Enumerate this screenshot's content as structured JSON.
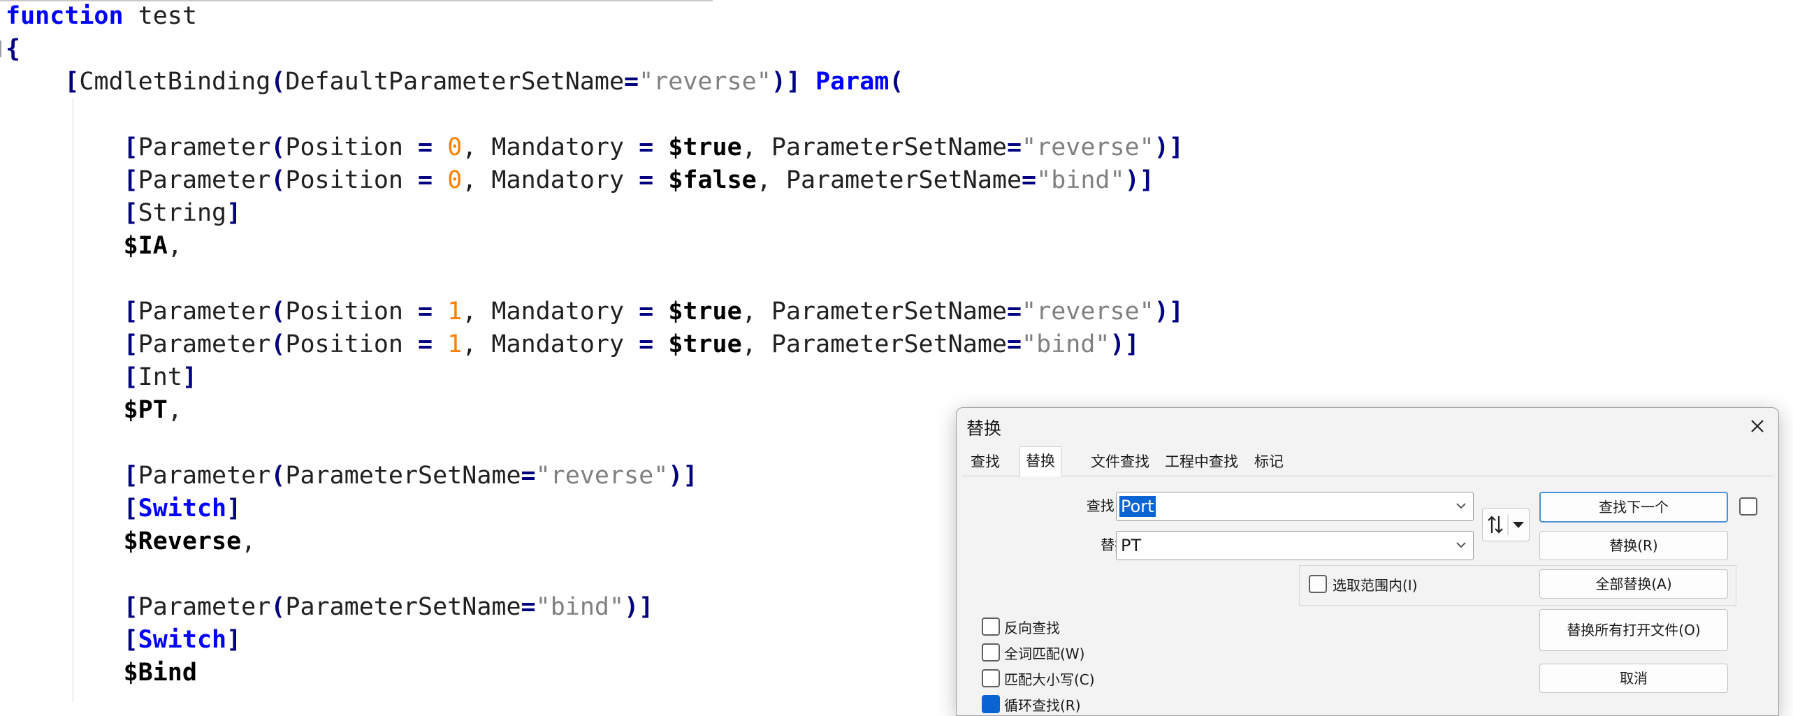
{
  "code": {
    "lines": [
      [
        [
          "kw",
          "function"
        ],
        [
          "text",
          " test"
        ]
      ],
      [
        [
          "brk",
          "{"
        ]
      ],
      [
        [
          "text",
          "    "
        ],
        [
          "brk",
          "["
        ],
        [
          "text",
          "CmdletBinding"
        ],
        [
          "brk",
          "("
        ],
        [
          "text",
          "DefaultParameterSetName"
        ],
        [
          "op",
          "="
        ],
        [
          "str",
          "\"reverse\""
        ],
        [
          "brk",
          ")]"
        ],
        [
          "text",
          " "
        ],
        [
          "kw",
          "Param"
        ],
        [
          "brk",
          "("
        ]
      ],
      [],
      [
        [
          "text",
          "        "
        ],
        [
          "brk",
          "["
        ],
        [
          "text",
          "Parameter"
        ],
        [
          "brk",
          "("
        ],
        [
          "text",
          "Position "
        ],
        [
          "op",
          "="
        ],
        [
          "text",
          " "
        ],
        [
          "num",
          "0"
        ],
        [
          "text",
          ", Mandatory "
        ],
        [
          "op",
          "="
        ],
        [
          "text",
          " "
        ],
        [
          "var",
          "$true"
        ],
        [
          "text",
          ", ParameterSetName"
        ],
        [
          "op",
          "="
        ],
        [
          "str",
          "\"reverse\""
        ],
        [
          "brk",
          ")]"
        ]
      ],
      [
        [
          "text",
          "        "
        ],
        [
          "brk",
          "["
        ],
        [
          "text",
          "Parameter"
        ],
        [
          "brk",
          "("
        ],
        [
          "text",
          "Position "
        ],
        [
          "op",
          "="
        ],
        [
          "text",
          " "
        ],
        [
          "num",
          "0"
        ],
        [
          "text",
          ", Mandatory "
        ],
        [
          "op",
          "="
        ],
        [
          "text",
          " "
        ],
        [
          "var",
          "$false"
        ],
        [
          "text",
          ", ParameterSetName"
        ],
        [
          "op",
          "="
        ],
        [
          "str",
          "\"bind\""
        ],
        [
          "brk",
          ")]"
        ]
      ],
      [
        [
          "text",
          "        "
        ],
        [
          "brk",
          "["
        ],
        [
          "text",
          "String"
        ],
        [
          "brk",
          "]"
        ]
      ],
      [
        [
          "text",
          "        "
        ],
        [
          "var",
          "$IA"
        ],
        [
          "text",
          ","
        ]
      ],
      [],
      [
        [
          "text",
          "        "
        ],
        [
          "brk",
          "["
        ],
        [
          "text",
          "Parameter"
        ],
        [
          "brk",
          "("
        ],
        [
          "text",
          "Position "
        ],
        [
          "op",
          "="
        ],
        [
          "text",
          " "
        ],
        [
          "num",
          "1"
        ],
        [
          "text",
          ", Mandatory "
        ],
        [
          "op",
          "="
        ],
        [
          "text",
          " "
        ],
        [
          "var",
          "$true"
        ],
        [
          "text",
          ", ParameterSetName"
        ],
        [
          "op",
          "="
        ],
        [
          "str",
          "\"reverse\""
        ],
        [
          "brk",
          ")]"
        ]
      ],
      [
        [
          "text",
          "        "
        ],
        [
          "brk",
          "["
        ],
        [
          "text",
          "Parameter"
        ],
        [
          "brk",
          "("
        ],
        [
          "text",
          "Position "
        ],
        [
          "op",
          "="
        ],
        [
          "text",
          " "
        ],
        [
          "num",
          "1"
        ],
        [
          "text",
          ", Mandatory "
        ],
        [
          "op",
          "="
        ],
        [
          "text",
          " "
        ],
        [
          "var",
          "$true"
        ],
        [
          "text",
          ", ParameterSetName"
        ],
        [
          "op",
          "="
        ],
        [
          "str",
          "\"bind\""
        ],
        [
          "brk",
          ")]"
        ]
      ],
      [
        [
          "text",
          "        "
        ],
        [
          "brk",
          "["
        ],
        [
          "text",
          "Int"
        ],
        [
          "brk",
          "]"
        ]
      ],
      [
        [
          "text",
          "        "
        ],
        [
          "var",
          "$PT"
        ],
        [
          "text",
          ","
        ]
      ],
      [],
      [
        [
          "text",
          "        "
        ],
        [
          "brk",
          "["
        ],
        [
          "text",
          "Parameter"
        ],
        [
          "brk",
          "("
        ],
        [
          "text",
          "ParameterSetName"
        ],
        [
          "op",
          "="
        ],
        [
          "str",
          "\"reverse\""
        ],
        [
          "brk",
          ")]"
        ]
      ],
      [
        [
          "text",
          "        "
        ],
        [
          "brk",
          "["
        ],
        [
          "sw",
          "Switch"
        ],
        [
          "brk",
          "]"
        ]
      ],
      [
        [
          "text",
          "        "
        ],
        [
          "var",
          "$Reverse"
        ],
        [
          "text",
          ","
        ]
      ],
      [],
      [
        [
          "text",
          "        "
        ],
        [
          "brk",
          "["
        ],
        [
          "text",
          "Parameter"
        ],
        [
          "brk",
          "("
        ],
        [
          "text",
          "ParameterSetName"
        ],
        [
          "op",
          "="
        ],
        [
          "str",
          "\"bind\""
        ],
        [
          "brk",
          ")]"
        ]
      ],
      [
        [
          "text",
          "        "
        ],
        [
          "brk",
          "["
        ],
        [
          "sw",
          "Switch"
        ],
        [
          "brk",
          "]"
        ]
      ],
      [
        [
          "text",
          "        "
        ],
        [
          "var",
          "$Bind"
        ]
      ]
    ]
  },
  "dialog": {
    "title": "替换",
    "tabs": [
      "查找",
      "替换",
      "文件查找",
      "工程中查找",
      "标记"
    ],
    "active_tab": 1,
    "find_label": "查找目标(F) :",
    "find_value": "Port",
    "replace_label": "替换为(L) :",
    "replace_value": "PT",
    "in_selection_label": "选取范围内(I)",
    "buttons": {
      "find_next": "查找下一个",
      "replace": "替换(R)",
      "replace_all": "全部替换(A)",
      "replace_all_open": "替换所有打开文件(O)",
      "cancel": "取消"
    },
    "options": [
      {
        "label": "反向查找",
        "checked": false
      },
      {
        "label": "全词匹配(W)",
        "checked": false
      },
      {
        "label": "匹配大小写(C)",
        "checked": false
      },
      {
        "label": "循环查找(R)",
        "checked": true
      }
    ]
  },
  "colors": {
    "keyword": "#0000ff",
    "bracket": "#000080",
    "string": "#808080",
    "number": "#ff8000",
    "accent": "#0a64d2"
  }
}
